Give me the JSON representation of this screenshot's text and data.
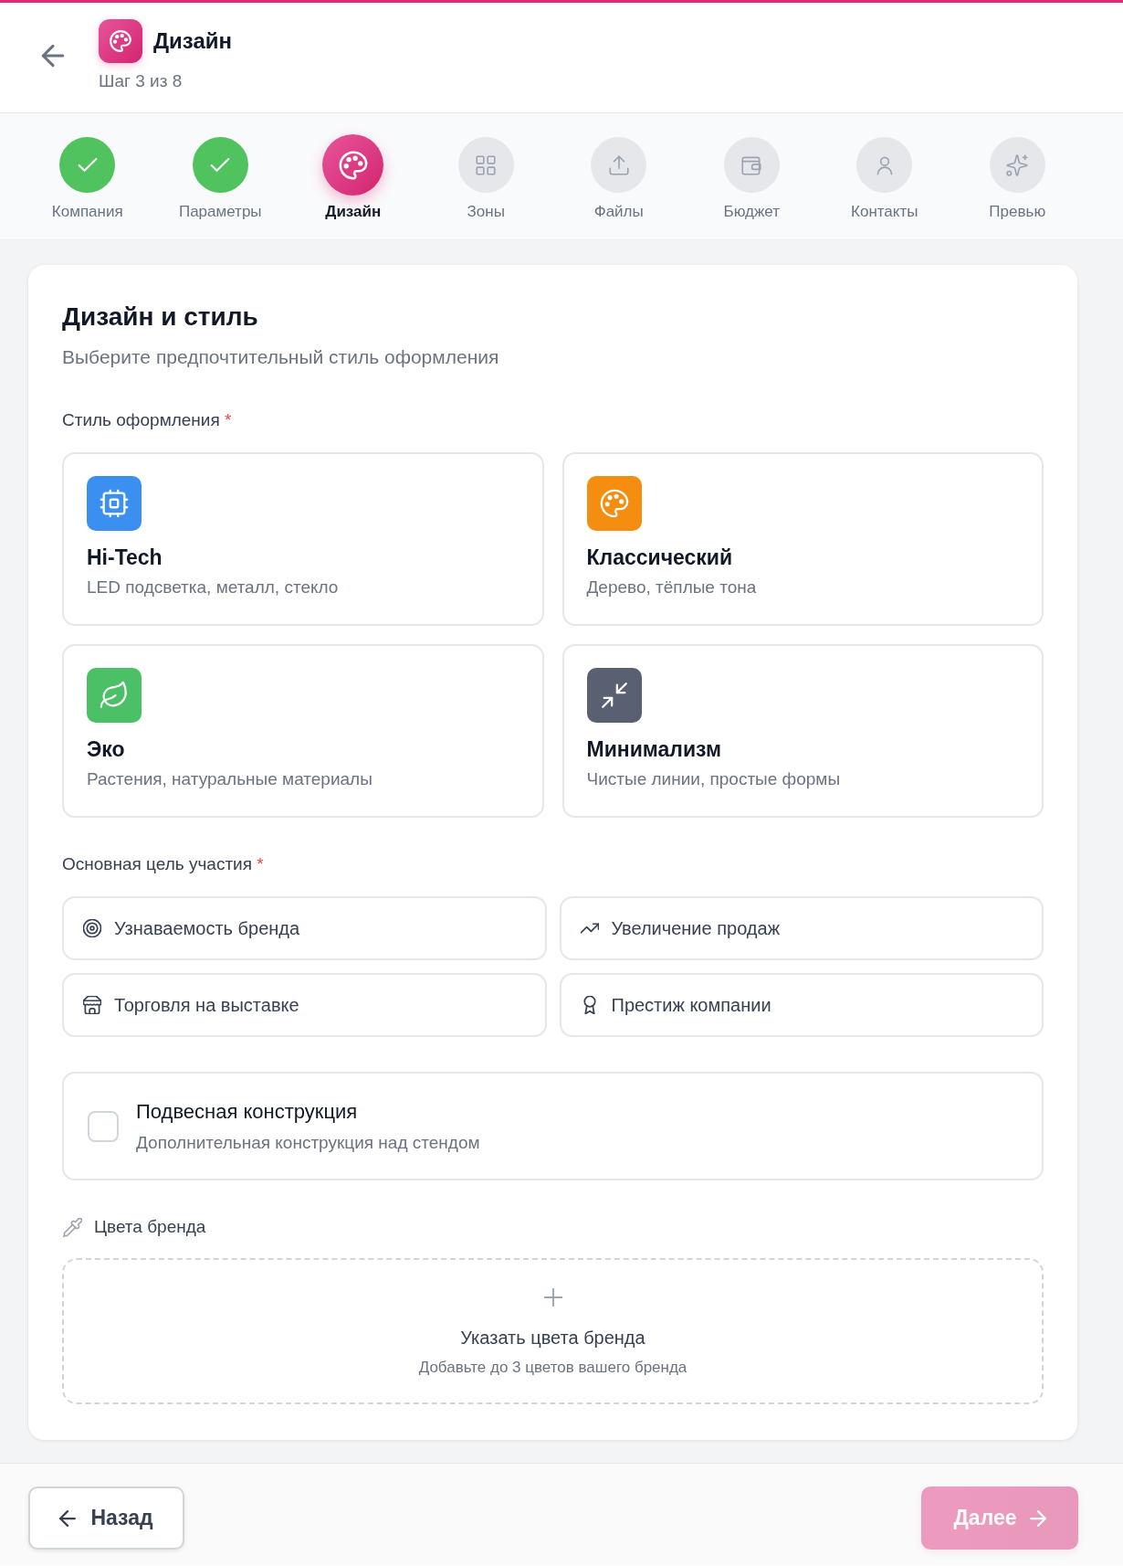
{
  "header": {
    "title": "Дизайн",
    "step": "Шаг 3 из 8"
  },
  "steps": [
    {
      "label": "Компания",
      "completed": true,
      "selected": false
    },
    {
      "label": "Параметры",
      "completed": true,
      "selected": false
    },
    {
      "label": "Дизайн",
      "completed": false,
      "selected": true
    },
    {
      "label": "Зоны",
      "completed": false,
      "selected": false
    },
    {
      "label": "Файлы",
      "completed": false,
      "selected": false
    },
    {
      "label": "Бюджет",
      "completed": false,
      "selected": false
    },
    {
      "label": "Контакты",
      "completed": false,
      "selected": false
    },
    {
      "label": "Превью",
      "completed": false,
      "selected": false
    }
  ],
  "section": {
    "title": "Дизайн и стиль",
    "subtitle": "Выберите предпочтительный стиль оформления"
  },
  "style_field": {
    "label": "Стиль оформления",
    "required_mark": "*",
    "options": [
      {
        "title": "Hi-Tech",
        "description": "LED подсветка, металл, стекло",
        "color": "#3b8ff0",
        "selected": false
      },
      {
        "title": "Классический",
        "description": "Дерево, тёплые тона",
        "color": "#f58d10",
        "selected": false
      },
      {
        "title": "Эко",
        "description": "Растения, натуральные материалы",
        "color": "#4cc066",
        "selected": false
      },
      {
        "title": "Минимализм",
        "description": "Чистые линии, простые формы",
        "color": "#596072",
        "selected": false
      }
    ]
  },
  "goal_field": {
    "label": "Основная цель участия",
    "required_mark": "*",
    "options": [
      {
        "label": "Узнаваемость бренда",
        "selected": false
      },
      {
        "label": "Увеличение продаж",
        "selected": false
      },
      {
        "label": "Торговля на выставке",
        "selected": false
      },
      {
        "label": "Престиж компании",
        "selected": false
      }
    ]
  },
  "suspended": {
    "title": "Подвесная конструкция",
    "description": "Дополнительная конструкция над стендом",
    "checked": false
  },
  "brand_colors": {
    "label": "Цвета бренда",
    "add_title": "Указать цвета бренда",
    "add_hint": "Добавьте до 3 цветов вашего бренда"
  },
  "footer": {
    "back": "Назад",
    "next": {
      "label": "Далее",
      "disabled": true
    }
  }
}
